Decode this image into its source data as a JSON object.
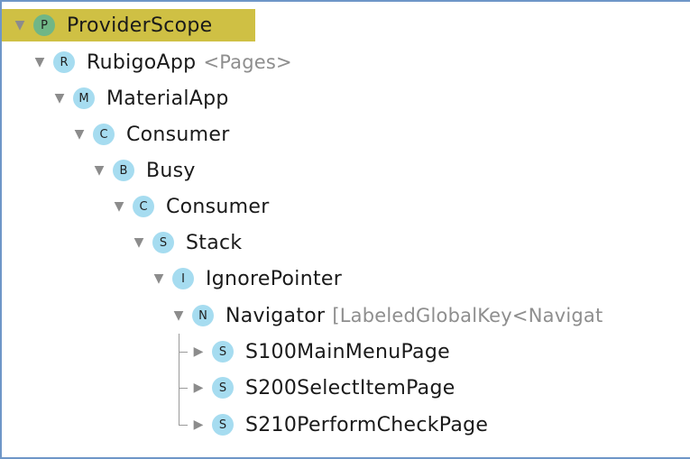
{
  "colors": {
    "selection_highlight": "#cfc044",
    "badge": "#a6dcf0",
    "selected_badge": "#70b686",
    "frame_border": "#6e96c8"
  },
  "tree": {
    "nodes": [
      {
        "badge": "P",
        "label": "ProviderScope",
        "detail": "",
        "expanded": true,
        "selected": true
      },
      {
        "badge": "R",
        "label": "RubigoApp",
        "detail": "<Pages>",
        "expanded": true
      },
      {
        "badge": "M",
        "label": "MaterialApp",
        "detail": "",
        "expanded": true
      },
      {
        "badge": "C",
        "label": "Consumer",
        "detail": "",
        "expanded": true
      },
      {
        "badge": "B",
        "label": "Busy",
        "detail": "",
        "expanded": true
      },
      {
        "badge": "C",
        "label": "Consumer",
        "detail": "",
        "expanded": true
      },
      {
        "badge": "S",
        "label": "Stack",
        "detail": "",
        "expanded": true
      },
      {
        "badge": "I",
        "label": "IgnorePointer",
        "detail": "",
        "expanded": true
      },
      {
        "badge": "N",
        "label": "Navigator",
        "detail": "[LabeledGlobalKey<Navigat",
        "expanded": true
      },
      {
        "badge": "S",
        "label": "S100MainMenuPage",
        "detail": "",
        "expanded": false
      },
      {
        "badge": "S",
        "label": "S200SelectItemPage",
        "detail": "",
        "expanded": false
      },
      {
        "badge": "S",
        "label": "S210PerformCheckPage",
        "detail": "",
        "expanded": false
      }
    ]
  }
}
